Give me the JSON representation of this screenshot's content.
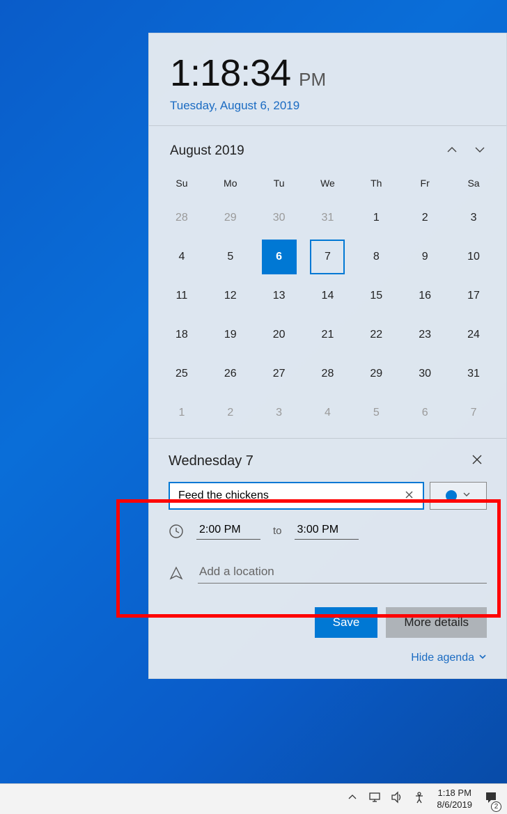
{
  "clock": {
    "time": "1:18:34",
    "ampm": "PM",
    "date": "Tuesday, August 6, 2019"
  },
  "calendar": {
    "month_label": "August 2019",
    "weekdays": [
      "Su",
      "Mo",
      "Tu",
      "We",
      "Th",
      "Fr",
      "Sa"
    ],
    "weeks": [
      [
        {
          "d": "28",
          "o": true
        },
        {
          "d": "29",
          "o": true
        },
        {
          "d": "30",
          "o": true
        },
        {
          "d": "31",
          "o": true
        },
        {
          "d": "1"
        },
        {
          "d": "2"
        },
        {
          "d": "3"
        }
      ],
      [
        {
          "d": "4"
        },
        {
          "d": "5"
        },
        {
          "d": "6",
          "today": true
        },
        {
          "d": "7",
          "selected": true
        },
        {
          "d": "8"
        },
        {
          "d": "9"
        },
        {
          "d": "10"
        }
      ],
      [
        {
          "d": "11"
        },
        {
          "d": "12"
        },
        {
          "d": "13"
        },
        {
          "d": "14"
        },
        {
          "d": "15"
        },
        {
          "d": "16"
        },
        {
          "d": "17"
        }
      ],
      [
        {
          "d": "18"
        },
        {
          "d": "19"
        },
        {
          "d": "20"
        },
        {
          "d": "21"
        },
        {
          "d": "22"
        },
        {
          "d": "23"
        },
        {
          "d": "24"
        }
      ],
      [
        {
          "d": "25"
        },
        {
          "d": "26"
        },
        {
          "d": "27"
        },
        {
          "d": "28"
        },
        {
          "d": "29"
        },
        {
          "d": "30"
        },
        {
          "d": "31"
        }
      ],
      [
        {
          "d": "1",
          "o": true
        },
        {
          "d": "2",
          "o": true
        },
        {
          "d": "3",
          "o": true
        },
        {
          "d": "4",
          "o": true
        },
        {
          "d": "5",
          "o": true
        },
        {
          "d": "6",
          "o": true
        },
        {
          "d": "7",
          "o": true
        }
      ]
    ]
  },
  "event": {
    "day_label": "Wednesday 7",
    "title": "Feed the chickens",
    "start": "2:00 PM",
    "to_label": "to",
    "end": "3:00 PM",
    "calendar_color": "#0078d4"
  },
  "location": {
    "placeholder": "Add a location"
  },
  "buttons": {
    "save": "Save",
    "details": "More details"
  },
  "hide_agenda": "Hide agenda",
  "tray": {
    "time": "1:18 PM",
    "date": "8/6/2019",
    "badge": "2"
  }
}
